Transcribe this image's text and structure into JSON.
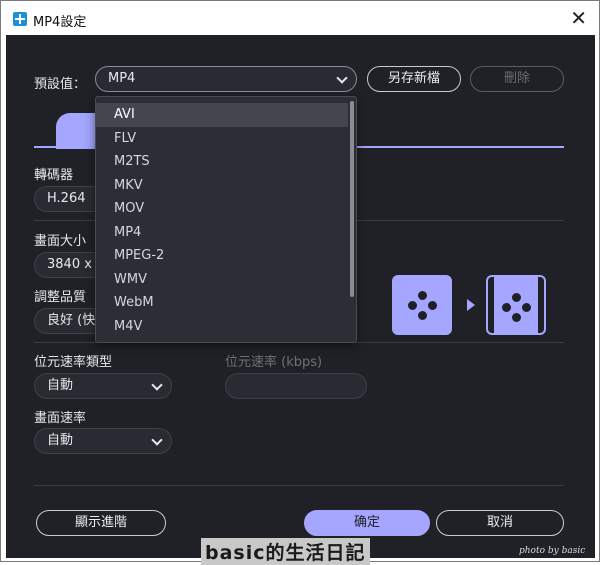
{
  "window": {
    "title": "MP4設定",
    "close_glyph": "✕"
  },
  "preset": {
    "label": "預設值：",
    "value": "MP4",
    "save_new_label": "另存新檔",
    "delete_label": "刪除",
    "options": [
      "AVI",
      "FLV",
      "M2TS",
      "MKV",
      "MOV",
      "MP4",
      "MPEG-2",
      "WMV",
      "WebM",
      "M4V"
    ],
    "highlighted": "AVI"
  },
  "codec": {
    "label": "轉碼器",
    "value": "H.264"
  },
  "frame_size": {
    "label": "畫面大小",
    "value": "3840 x"
  },
  "quality": {
    "label": "調整品質",
    "value": "良好 (快"
  },
  "bitrate_type": {
    "label": "位元速率類型",
    "value": "自動"
  },
  "bitrate": {
    "label": "位元速率 (kbps)",
    "value": ""
  },
  "frame_rate": {
    "label": "畫面速率",
    "value": "自動"
  },
  "footer": {
    "advanced_label": "顯示進階",
    "ok_label": "确定",
    "cancel_label": "取消"
  },
  "watermark": {
    "center": "basic的生活日記",
    "right": "photo by basic"
  },
  "colors": {
    "accent": "#a4a6ff",
    "background": "#202127",
    "field": "#2a2b32"
  }
}
